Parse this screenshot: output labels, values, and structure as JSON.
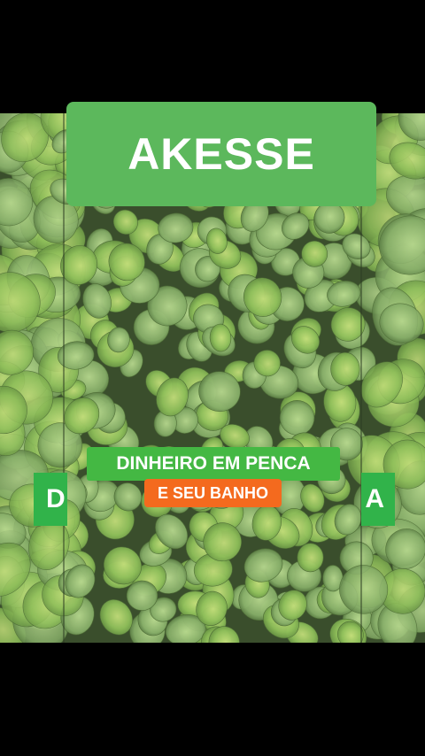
{
  "title_banner": {
    "text": "AKESSE"
  },
  "caption": {
    "line1": "DINHEIRO EM PENCA",
    "line2": "E SEU BANHO"
  },
  "side_caption": {
    "left_fragment": "D",
    "right_fragment": "A"
  },
  "colors": {
    "banner": "#5cb85c",
    "caption_green": "#44b843",
    "caption_orange": "#f46a1e",
    "leaves": "#8fbf5a"
  }
}
